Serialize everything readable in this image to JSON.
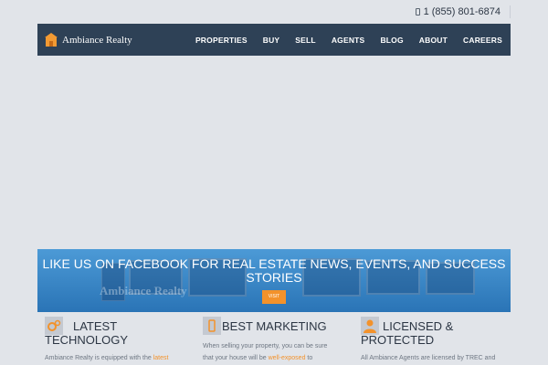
{
  "topbar": {
    "phone": "1 (855) 801-6874",
    "phone_icon": "mobile-phone-icon"
  },
  "nav": {
    "brand": "Ambiance Realty",
    "logo_icon": "house-logo-icon",
    "items": [
      "PROPERTIES",
      "BUY",
      "SELL",
      "AGENTS",
      "BLOG",
      "ABOUT",
      "CAREERS"
    ]
  },
  "facebook_band": {
    "prefix": "LIKE US ON",
    "link": "FACEBOOK",
    "suffix": "FOR REAL ESTATE NEWS, EVENTS, AND SUCCESS STORIES",
    "button": "VISIT",
    "background_text": "Ambiance Realty"
  },
  "features": [
    {
      "icon": "gears-icon",
      "title_line1": "LATEST",
      "title_line2": "TECHNOLOGY",
      "text_before": "Ambiance Realty is equipped with the",
      "text_link": "latest"
    },
    {
      "icon": "mobile-phone-icon",
      "title_line1": "BEST MARKETING",
      "text_line1": "When selling your property, you can be sure",
      "text_before": "that your house will be",
      "text_link": "well-exposed",
      "text_after": "to"
    },
    {
      "icon": "user-icon",
      "title_line1": "LICENSED &",
      "title_line2": "PROTECTED",
      "text_before": "All Ambiance Agents are licensed by TREC and"
    }
  ],
  "colors": {
    "navbar": "#2e4156",
    "accent": "#f3922b",
    "band": "#3d8ccc",
    "page": "#e1e4e9"
  }
}
